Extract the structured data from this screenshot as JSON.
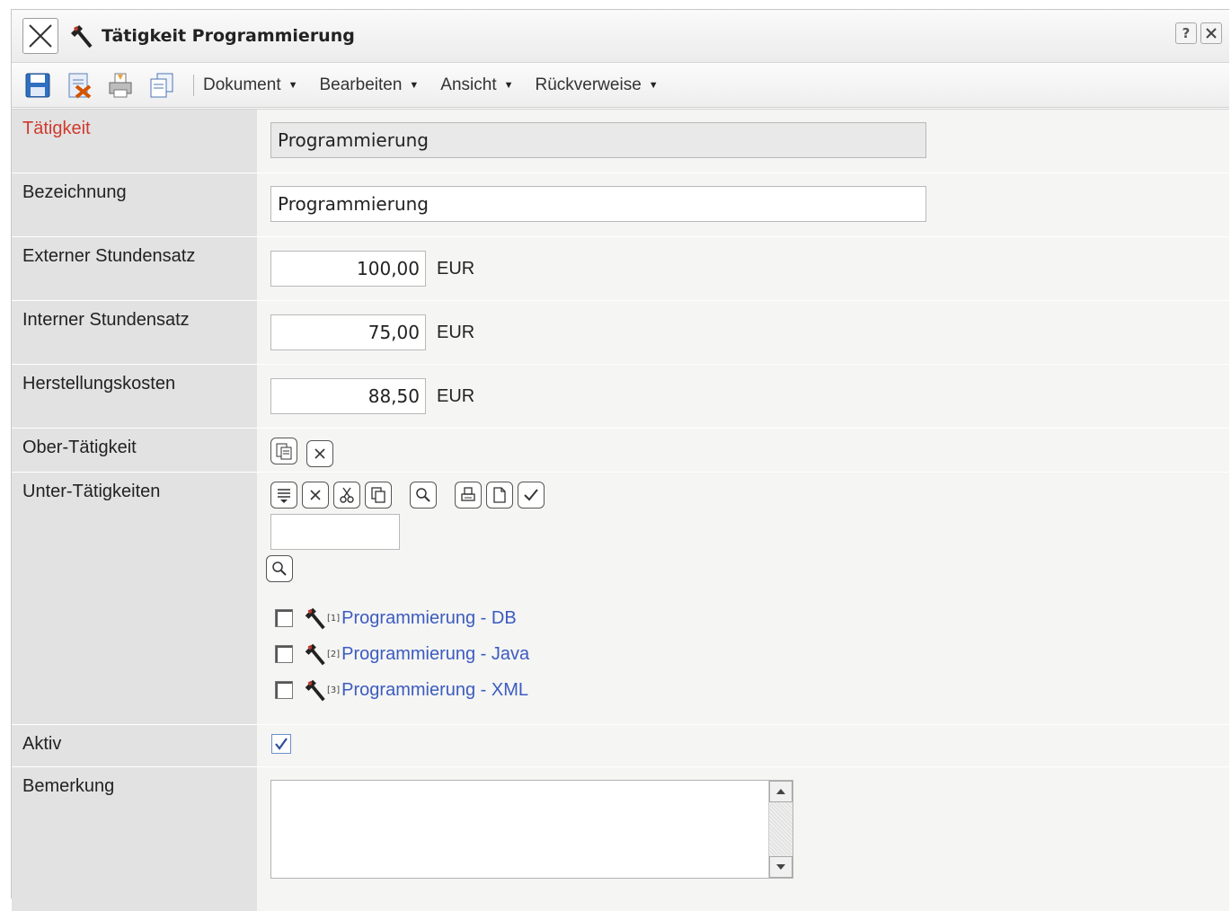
{
  "window": {
    "title": "Tätigkeit Programmierung"
  },
  "titlebar": {
    "help_label": "?"
  },
  "menus": [
    {
      "label": "Dokument"
    },
    {
      "label": "Bearbeiten"
    },
    {
      "label": "Ansicht"
    },
    {
      "label": "Rückverweise"
    }
  ],
  "form": {
    "taetigkeit": {
      "label": "Tätigkeit",
      "value": "Programmierung"
    },
    "bezeichnung": {
      "label": "Bezeichnung",
      "value": "Programmierung"
    },
    "extern": {
      "label": "Externer Stundensatz",
      "value": "100,00",
      "unit": "EUR"
    },
    "intern": {
      "label": "Interner Stundensatz",
      "value": "75,00",
      "unit": "EUR"
    },
    "kosten": {
      "label": "Herstellungskosten",
      "value": "88,50",
      "unit": "EUR"
    },
    "ober": {
      "label": "Ober-Tätigkeit"
    },
    "unter": {
      "label": "Unter-Tätigkeiten",
      "search_value": "",
      "items": [
        {
          "index": "[1]",
          "label": "Programmierung - DB"
        },
        {
          "index": "[2]",
          "label": "Programmierung - Java"
        },
        {
          "index": "[3]",
          "label": "Programmierung - XML"
        }
      ]
    },
    "aktiv": {
      "label": "Aktiv",
      "checked": true
    },
    "bemerkung": {
      "label": "Bemerkung",
      "value": ""
    }
  },
  "colors": {
    "required_label": "#d03a2e",
    "link": "#3b5bbf"
  }
}
